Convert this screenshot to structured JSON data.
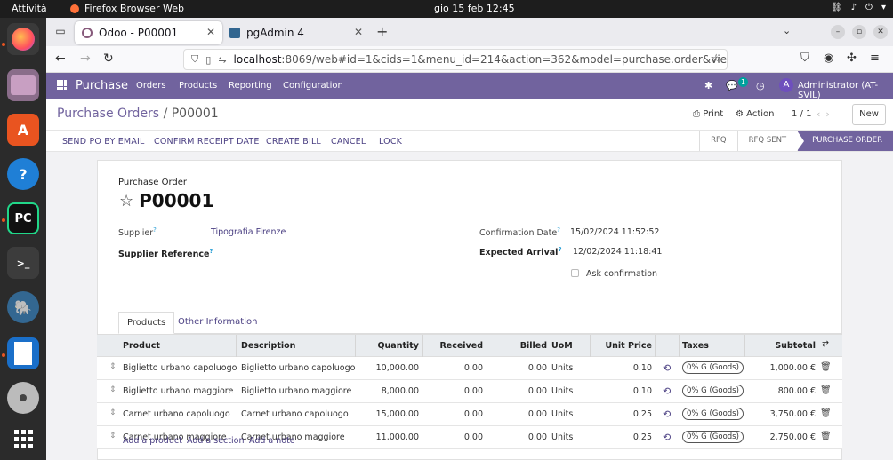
{
  "os": {
    "activities": "Attività",
    "app_name": "Firefox Browser Web",
    "clock": "gio 15 feb  12:45"
  },
  "browser": {
    "tabs": [
      {
        "title": "Odoo - P00001",
        "active": true
      },
      {
        "title": "pgAdmin 4",
        "active": false
      }
    ],
    "url_host": "localhost",
    "url_rest": ":8069/web#id=1&cids=1&menu_id=214&action=362&model=purchase.order&view_type=for"
  },
  "odoo": {
    "app": "Purchase",
    "menu": [
      "Orders",
      "Products",
      "Reporting",
      "Configuration"
    ],
    "chat_badge": "1",
    "avatar_letter": "A",
    "user": "Administrator (AT-SVIL)"
  },
  "control": {
    "breadcrumb_parent": "Purchase Orders",
    "breadcrumb_sep": "/",
    "breadcrumb_current": "P00001",
    "print": "Print",
    "action": "Action",
    "pager": "1 / 1",
    "new": "New"
  },
  "buttons": [
    "SEND PO BY EMAIL",
    "CONFIRM RECEIPT DATE",
    "CREATE BILL",
    "CANCEL",
    "LOCK"
  ],
  "stages": [
    "RFQ",
    "RFQ SENT",
    "PURCHASE ORDER"
  ],
  "form": {
    "doc_type": "Purchase Order",
    "name": "P00001",
    "supplier_label": "Supplier",
    "supplier": "Tipografia Firenze",
    "supplier_ref_label": "Supplier Reference",
    "confirmation_label": "Confirmation Date",
    "confirmation": "15/02/2024 11:52:52",
    "expected_label": "Expected Arrival",
    "expected": "12/02/2024 11:18:41",
    "ask_confirmation": "Ask confirmation",
    "help_mark": "?"
  },
  "notebook": {
    "tab_products": "Products",
    "tab_other": "Other Information"
  },
  "table": {
    "headers": {
      "product": "Product",
      "description": "Description",
      "quantity": "Quantity",
      "received": "Received",
      "billed": "Billed",
      "uom": "UoM",
      "unit_price": "Unit Price",
      "taxes": "Taxes",
      "subtotal": "Subtotal"
    },
    "rows": [
      {
        "product": "Biglietto urbano capoluogo",
        "description": "Biglietto urbano capoluogo",
        "quantity": "10,000.00",
        "received": "0.00",
        "billed": "0.00",
        "uom": "Units",
        "unit_price": "0.10",
        "tax": "0% G (Goods)",
        "subtotal": "1,000.00 €"
      },
      {
        "product": "Biglietto urbano maggiore",
        "description": "Biglietto urbano maggiore",
        "quantity": "8,000.00",
        "received": "0.00",
        "billed": "0.00",
        "uom": "Units",
        "unit_price": "0.10",
        "tax": "0% G (Goods)",
        "subtotal": "800.00 €"
      },
      {
        "product": "Carnet urbano capoluogo",
        "description": "Carnet urbano capoluogo",
        "quantity": "15,000.00",
        "received": "0.00",
        "billed": "0.00",
        "uom": "Units",
        "unit_price": "0.25",
        "tax": "0% G (Goods)",
        "subtotal": "3,750.00 €"
      },
      {
        "product": "Carnet urbano maggiore",
        "description": "Carnet urbano maggiore",
        "quantity": "11,000.00",
        "received": "0.00",
        "billed": "0.00",
        "uom": "Units",
        "unit_price": "0.25",
        "tax": "0% G (Goods)",
        "subtotal": "2,750.00 €"
      }
    ],
    "add_product": "Add a product",
    "add_section": "Add a section",
    "add_note": "Add a note"
  },
  "colors": {
    "odoo_primary": "#71639e",
    "link": "#4a3f82",
    "help": "#2a9fd6"
  }
}
